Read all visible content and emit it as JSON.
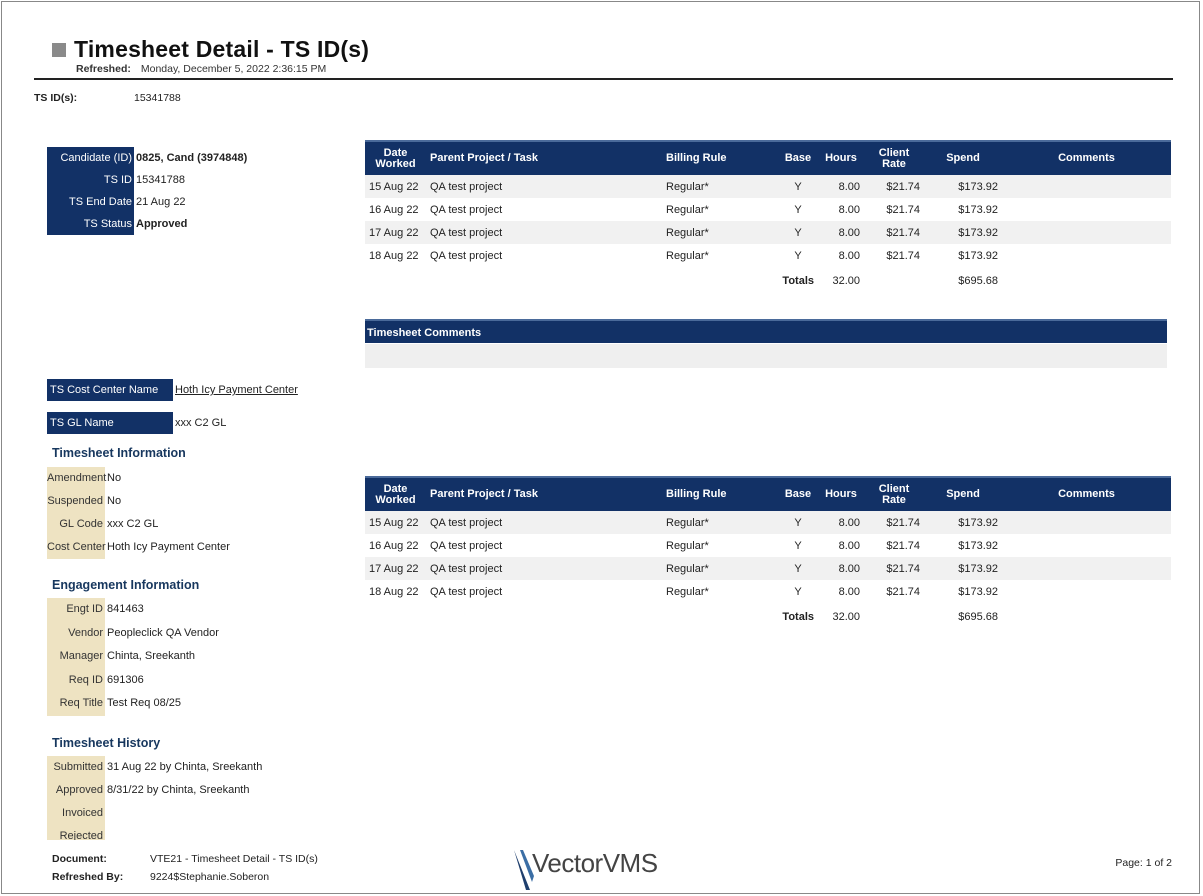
{
  "header": {
    "title": "Timesheet Detail - TS ID(s)",
    "refreshed_label": "Refreshed:",
    "refreshed_value": "Monday, December 5, 2022 2:36:15 PM",
    "tsids_label": "TS ID(s):",
    "tsids_value": "15341788"
  },
  "candidate_block": [
    {
      "label": "Candidate (ID)",
      "value": "0825, Cand (3974848)",
      "bold": true
    },
    {
      "label": "TS ID",
      "value": "15341788",
      "bold": false
    },
    {
      "label": "TS End Date",
      "value": "21 Aug 22",
      "bold": false
    },
    {
      "label": "TS Status",
      "value": "Approved",
      "bold": true
    }
  ],
  "cost_center": {
    "label": "TS Cost Center Name",
    "value": "Hoth Icy Payment Center"
  },
  "gl_name": {
    "label": "TS GL Name",
    "value": "xxx C2 GL"
  },
  "timesheet_info": {
    "heading": "Timesheet Information",
    "rows": [
      {
        "label": "Amendment",
        "value": "No"
      },
      {
        "label": "Suspended",
        "value": "No"
      },
      {
        "label": "GL Code",
        "value": "xxx C2 GL"
      },
      {
        "label": "Cost Center",
        "value": "Hoth Icy Payment Center"
      }
    ]
  },
  "engagement_info": {
    "heading": "Engagement Information",
    "rows": [
      {
        "label": "Engt ID",
        "value": "841463"
      },
      {
        "label": "Vendor",
        "value": "Peopleclick QA Vendor"
      },
      {
        "label": "Manager",
        "value": "Chinta, Sreekanth"
      },
      {
        "label": "Req ID",
        "value": "691306"
      },
      {
        "label": "Req Title",
        "value": "Test Req 08/25"
      }
    ]
  },
  "history": {
    "heading": "Timesheet History",
    "rows": [
      {
        "label": "Submitted",
        "value": "31 Aug 22  by Chinta, Sreekanth"
      },
      {
        "label": "Approved",
        "value": "8/31/22     by Chinta, Sreekanth"
      },
      {
        "label": "Invoiced",
        "value": ""
      },
      {
        "label": "Rejected",
        "value": ""
      }
    ]
  },
  "table_columns": {
    "date_worked_1": "Date",
    "date_worked_2": "Worked",
    "project": "Parent Project / Task",
    "billing_rule": "Billing Rule",
    "base": "Base",
    "hours": "Hours",
    "client_rate_1": "Client",
    "client_rate_2": "Rate",
    "spend": "Spend",
    "comments": "Comments"
  },
  "table1": {
    "rows": [
      {
        "date": "15 Aug 22",
        "project": "QA test project",
        "billing_rule": "Regular*",
        "base": "Y",
        "hours": "8.00",
        "rate": "$21.74",
        "spend": "$173.92",
        "comments": ""
      },
      {
        "date": "16 Aug 22",
        "project": "QA test project",
        "billing_rule": "Regular*",
        "base": "Y",
        "hours": "8.00",
        "rate": "$21.74",
        "spend": "$173.92",
        "comments": ""
      },
      {
        "date": "17 Aug 22",
        "project": "QA test project",
        "billing_rule": "Regular*",
        "base": "Y",
        "hours": "8.00",
        "rate": "$21.74",
        "spend": "$173.92",
        "comments": ""
      },
      {
        "date": "18 Aug 22",
        "project": "QA test project",
        "billing_rule": "Regular*",
        "base": "Y",
        "hours": "8.00",
        "rate": "$21.74",
        "spend": "$173.92",
        "comments": ""
      }
    ],
    "totals_label": "Totals",
    "totals_hours": "32.00",
    "totals_spend": "$695.68"
  },
  "timesheet_comments_heading": "Timesheet Comments",
  "table2": {
    "rows": [
      {
        "date": "15 Aug 22",
        "project": "QA test project",
        "billing_rule": "Regular*",
        "base": "Y",
        "hours": "8.00",
        "rate": "$21.74",
        "spend": "$173.92",
        "comments": ""
      },
      {
        "date": "16 Aug 22",
        "project": "QA test project",
        "billing_rule": "Regular*",
        "base": "Y",
        "hours": "8.00",
        "rate": "$21.74",
        "spend": "$173.92",
        "comments": ""
      },
      {
        "date": "17 Aug 22",
        "project": "QA test project",
        "billing_rule": "Regular*",
        "base": "Y",
        "hours": "8.00",
        "rate": "$21.74",
        "spend": "$173.92",
        "comments": ""
      },
      {
        "date": "18 Aug 22",
        "project": "QA test project",
        "billing_rule": "Regular*",
        "base": "Y",
        "hours": "8.00",
        "rate": "$21.74",
        "spend": "$173.92",
        "comments": ""
      }
    ],
    "totals_label": "Totals",
    "totals_hours": "32.00",
    "totals_spend": "$695.68"
  },
  "footer": {
    "document_label": "Document:",
    "document_value": "VTE21 - Timesheet Detail - TS ID(s)",
    "refreshed_by_label": "Refreshed By:",
    "refreshed_by_value": "9224$Stephanie.Soberon",
    "logo_text": "VectorVMS",
    "page": "Page: 1 of 2"
  },
  "colors": {
    "navy": "#123166",
    "tan": "#eee3c2",
    "heading": "#17375e"
  }
}
